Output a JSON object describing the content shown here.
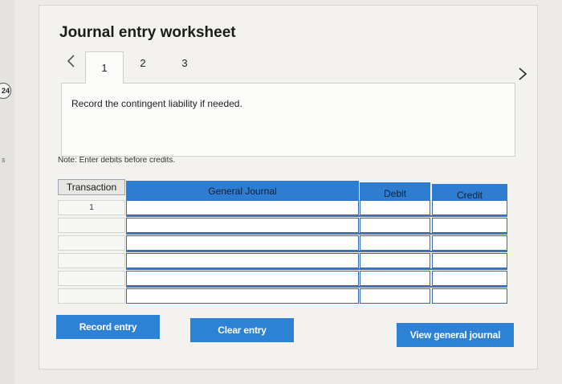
{
  "edge": {
    "badge": "24",
    "mark": "s"
  },
  "worksheet": {
    "title": "Journal entry worksheet",
    "tabs": [
      "1",
      "2",
      "3"
    ],
    "active_tab": "1"
  },
  "prompt": "Record the contingent liability if needed.",
  "note": "Note: Enter debits before credits.",
  "table": {
    "headers": {
      "transaction": "Transaction",
      "general_journal": "General Journal",
      "debit": "Debit",
      "credit": "Credit"
    },
    "rows": [
      {
        "transaction": "1",
        "account": "",
        "debit": "",
        "credit": ""
      },
      {
        "transaction": "",
        "account": "",
        "debit": "",
        "credit": ""
      },
      {
        "transaction": "",
        "account": "",
        "debit": "",
        "credit": ""
      },
      {
        "transaction": "",
        "account": "",
        "debit": "",
        "credit": ""
      },
      {
        "transaction": "",
        "account": "",
        "debit": "",
        "credit": ""
      },
      {
        "transaction": "",
        "account": "",
        "debit": "",
        "credit": ""
      }
    ]
  },
  "buttons": {
    "record": "Record entry",
    "clear": "Clear entry",
    "view": "View general journal"
  },
  "colors": {
    "accent": "#2e82d6",
    "header_blue": "#2f7dd0",
    "panel": "#f3f2ef"
  }
}
